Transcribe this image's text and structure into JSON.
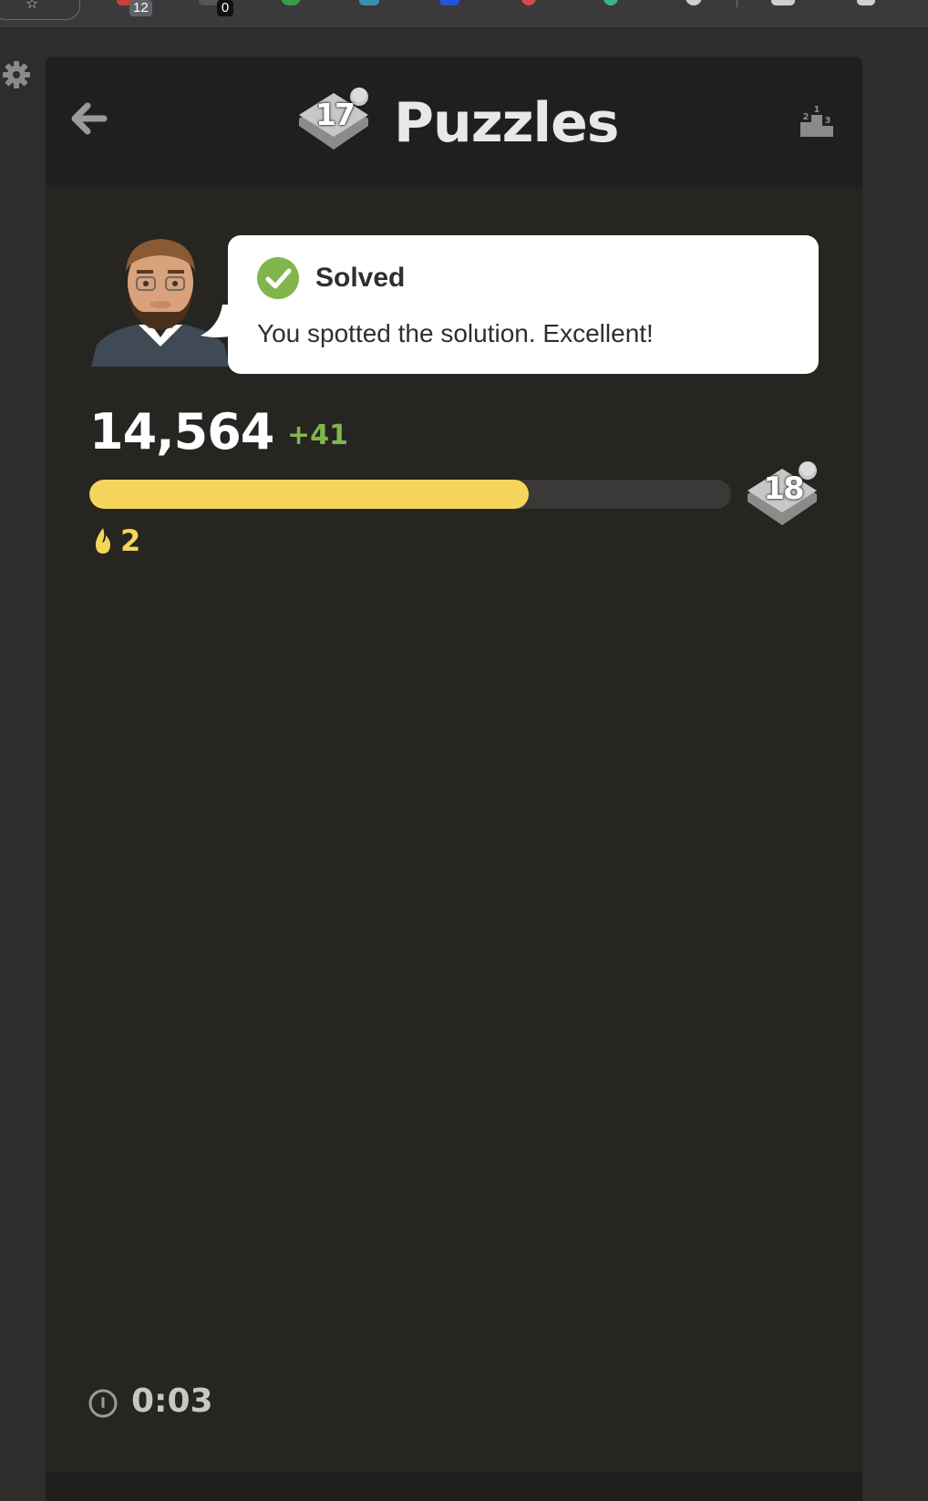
{
  "extensions": {
    "badges": [
      "12",
      "0"
    ]
  },
  "header": {
    "title": "Puzzles",
    "level_badge": "17"
  },
  "coach_message": {
    "status": "Solved",
    "text": "You spotted the solution. Excellent!"
  },
  "stats": {
    "rating": "14,564",
    "rating_change": "+41",
    "progress_fraction": 0.685,
    "next_level_badge": "18",
    "streak": "2",
    "timer": "0:03"
  },
  "colors": {
    "progress_fill": "#f5d55b",
    "success_green": "#81b64c",
    "panel_bg": "#262522"
  },
  "icons": [
    "star-icon",
    "gear-icon",
    "back-arrow-icon",
    "puzzle-piece-icon",
    "leaderboard-icon",
    "check-icon",
    "flame-icon",
    "timer-icon"
  ]
}
